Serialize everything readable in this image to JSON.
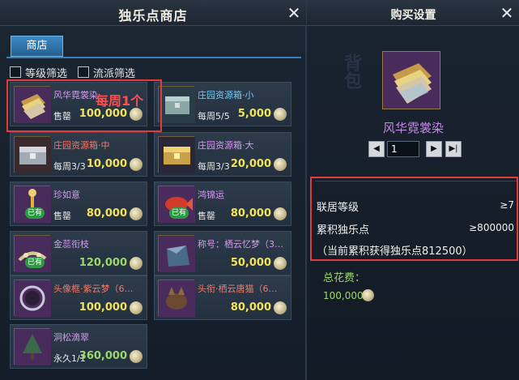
{
  "shop": {
    "title": "独乐点商店",
    "tab": "商店",
    "filters": [
      "等级筛选",
      "流派筛选"
    ],
    "annotation": "每周1个",
    "items": [
      {
        "name": "风华霓裳染",
        "sub": "售罄",
        "price": "100,000",
        "owned": "",
        "color": "purple",
        "icon": "cloth-bundle-icon"
      },
      {
        "name": "庄园资源箱·小",
        "sub": "每周5/5",
        "price": "5,000",
        "owned": "",
        "color": "blue",
        "icon": "chest-small-icon"
      },
      {
        "name": "庄园资源箱·中",
        "sub": "每周3/3",
        "price": "10,000",
        "owned": "",
        "color": "red",
        "icon": "chest-medium-icon"
      },
      {
        "name": "庄园资源箱·大",
        "sub": "每周3/3",
        "price": "20,000",
        "owned": "",
        "color": "purple",
        "icon": "chest-large-icon"
      },
      {
        "name": "珍如意",
        "sub": "售罄",
        "price": "80,000",
        "owned": "已有",
        "color": "purple",
        "icon": "ruyi-icon"
      },
      {
        "name": "鸿锦运",
        "sub": "售罄",
        "price": "80,000",
        "owned": "已有",
        "color": "purple",
        "icon": "koi-icon"
      },
      {
        "name": "金蕊衔枝",
        "sub": "",
        "price": "120,000",
        "owned": "已有",
        "color": "purple",
        "icon": "gold-branch-icon"
      },
      {
        "name": "称号：栖云忆梦（3…",
        "sub": "",
        "price": "50,000",
        "owned": "",
        "color": "purple",
        "icon": "title-bag-icon"
      },
      {
        "name": "头像框·紫云梦（6…",
        "sub": "",
        "price": "100,000",
        "owned": "",
        "color": "red",
        "icon": "avatar-frame-icon"
      },
      {
        "name": "头衔·栖云唐猫（6…",
        "sub": "",
        "price": "80,000",
        "owned": "",
        "color": "red",
        "icon": "cat-icon"
      },
      {
        "name": "洞松滴翠",
        "sub": "永久1/1",
        "price": "360,000",
        "owned": "",
        "color": "purple",
        "icon": "pine-icon"
      }
    ]
  },
  "purchase": {
    "title": "购买设置",
    "item_name": "风华霓裳染",
    "quantity": "1",
    "req1_label": "联居等级",
    "req1_value": "≥7",
    "req2_label": "累积独乐点",
    "req2_value": "≥800000",
    "current": "（当前累积获得独乐点812500）",
    "total_label": "总花费：",
    "total_value": "100,000"
  },
  "colors": {
    "accent": "#3d8ac4",
    "price": "#f2e35a",
    "annotation": "#e23b3b",
    "total": "#9bd86a"
  }
}
